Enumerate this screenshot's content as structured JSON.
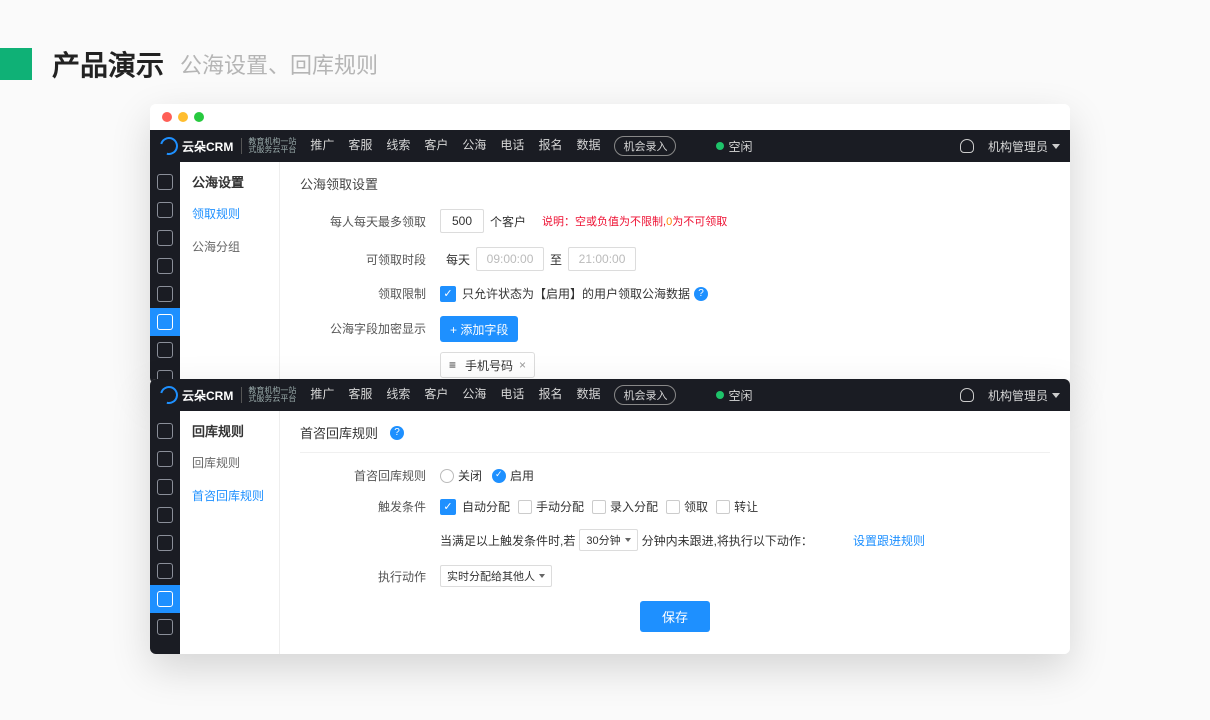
{
  "slide": {
    "title": "产品演示",
    "subtitle": "公海设置、回库规则"
  },
  "logo": {
    "brand": "云朵CRM",
    "sub1": "教育机构一站",
    "sub2": "式服务云平台"
  },
  "topnav": [
    "推广",
    "客服",
    "线索",
    "客户",
    "公海",
    "电话",
    "报名",
    "数据"
  ],
  "outline_btn": "机会录入",
  "status_text": "空闲",
  "user_label": "机构管理员",
  "panel1": {
    "side_title": "公海设置",
    "side_items": [
      "领取规则",
      "公海分组"
    ],
    "section": "公海领取设置",
    "rows": {
      "r1": {
        "label": "每人每天最多领取",
        "value": "500",
        "unit": "个客户",
        "note_prefix": "说明：",
        "note1": "空或负值为不限制",
        "note_zero": "0",
        "note2": "为不可领取"
      },
      "r2": {
        "label": "可领取时段",
        "prefix": "每天",
        "t1": "09:00:00",
        "mid": "至",
        "t2": "21:00:00"
      },
      "r3": {
        "label": "领取限制",
        "text": "只允许状态为【启用】的用户领取公海数据"
      },
      "r4": {
        "label": "公海字段加密显示",
        "btn": "+ 添加字段",
        "tag": "手机号码"
      }
    }
  },
  "panel2": {
    "side_title": "回库规则",
    "side_items": [
      "回库规则",
      "首咨回库规则"
    ],
    "section": "首咨回库规则",
    "rows": {
      "r1": {
        "label": "首咨回库规则",
        "off": "关闭",
        "on": "启用"
      },
      "r2": {
        "label": "触发条件",
        "c1": "自动分配",
        "c2": "手动分配",
        "c3": "录入分配",
        "c4": "领取",
        "c5": "转让"
      },
      "r3": {
        "pre": "当满足以上触发条件时,若",
        "sel": "30分钟",
        "mid": "分钟内未跟进,将执行以下动作：",
        "link": "设置跟进规则"
      },
      "r4": {
        "label": "执行动作",
        "sel": "实时分配给其他人"
      }
    },
    "save": "保存"
  }
}
